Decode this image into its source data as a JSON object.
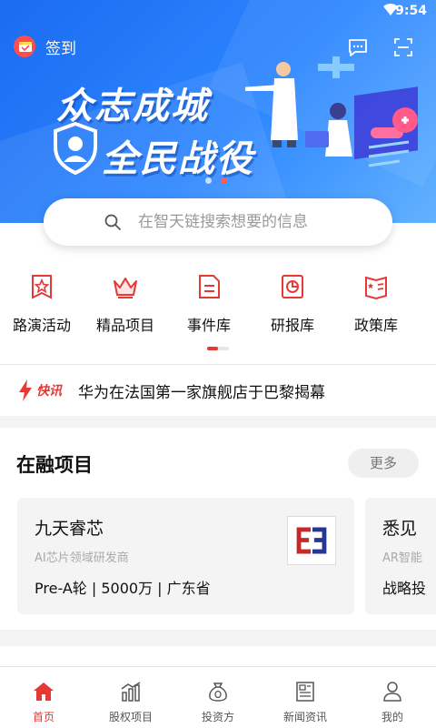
{
  "status_bar": {
    "time": "9:54"
  },
  "header": {
    "checkin_label": "签到"
  },
  "banner": {
    "line1": "众志成城",
    "line2": "全民战役"
  },
  "search": {
    "placeholder": "在智天链搜索想要的信息"
  },
  "categories": [
    {
      "label": "路演活动",
      "icon": "star-badge-icon"
    },
    {
      "label": "精品项目",
      "icon": "crown-icon"
    },
    {
      "label": "事件库",
      "icon": "document-icon"
    },
    {
      "label": "研报库",
      "icon": "pie-chart-icon"
    },
    {
      "label": "政策库",
      "icon": "policy-book-icon"
    }
  ],
  "flash_news": {
    "tag": "快讯",
    "headline": "华为在法国第一家旗舰店于巴黎揭幕"
  },
  "funding": {
    "title": "在融项目",
    "more_label": "更多",
    "projects": [
      {
        "name": "九天睿芯",
        "desc": "AI芯片领域研发商",
        "meta": "Pre-A轮 | 5000万 | 广东省"
      },
      {
        "name": "悉见",
        "desc": "AR智能",
        "meta": "战略投"
      }
    ]
  },
  "bottom_nav": [
    {
      "label": "首页",
      "icon": "home-icon",
      "active": true
    },
    {
      "label": "股权项目",
      "icon": "bar-chart-icon",
      "active": false
    },
    {
      "label": "投资方",
      "icon": "money-bag-icon",
      "active": false
    },
    {
      "label": "新闻资讯",
      "icon": "newspaper-icon",
      "active": false
    },
    {
      "label": "我的",
      "icon": "user-icon",
      "active": false
    }
  ],
  "colors": {
    "accent": "#e53935",
    "banner": "#2d86ff"
  }
}
